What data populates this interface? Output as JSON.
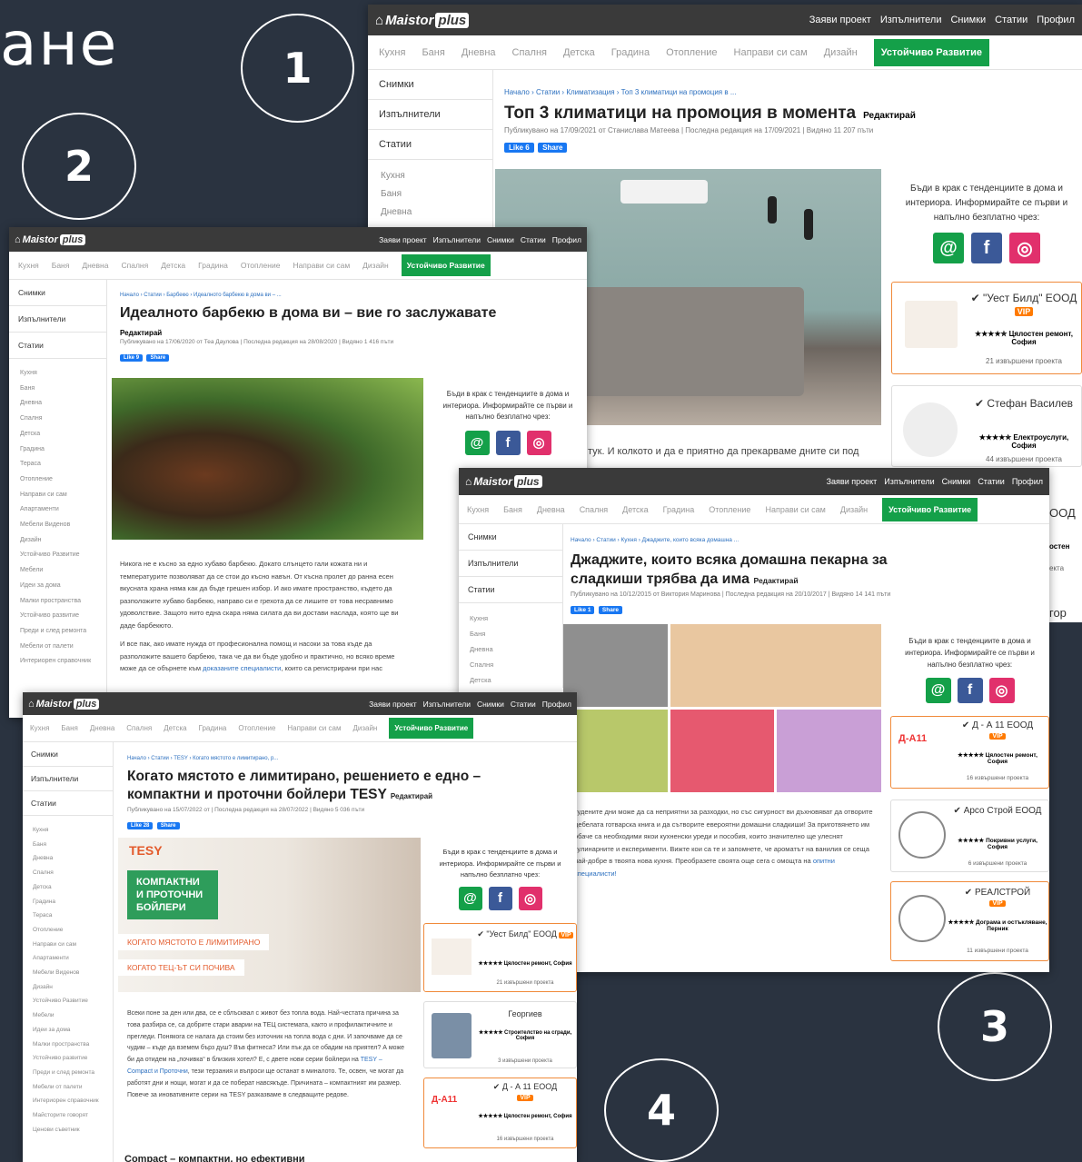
{
  "frag_top_left": "ане",
  "circles": [
    "1",
    "2",
    "3",
    "4"
  ],
  "common": {
    "logo_word": "Maistor",
    "logo_plus": "plus",
    "top_links": [
      "Заяви проект",
      "Изпълнители",
      "Снимки",
      "Статии",
      "Профил"
    ],
    "categories": [
      "Кухня",
      "Баня",
      "Дневна",
      "Спалня",
      "Детска",
      "Градина",
      "Отопление",
      "Направи си сам",
      "Дизайн"
    ],
    "green_cat": "Устойчиво Развитие",
    "side_menu": [
      "Снимки",
      "Изпълнители",
      "Статии"
    ],
    "edit": "Редактирай",
    "like": "Like",
    "share": "Share",
    "follow_text": "Бъди в крак с тенденциите в дома и интериора. Информирайте се първи и напълно безплатно чрез:",
    "social": [
      "@",
      "f",
      "◎"
    ],
    "vip": "VIP"
  },
  "s1": {
    "crumb": "Начало › Статии › Климатизация › Топ 3 климатици на промоция в ...",
    "title": "Топ 3 климатици на промоция в момента",
    "meta": "Публикувано на 17/09/2021 от Станислава Матеева | Последна редакция на 17/09/2021 | Видяно 11 207 пъти",
    "likes": "6",
    "side_sub": [
      "Кухня",
      "Баня",
      "Дневна"
    ],
    "body_line": "тук. И колкото и да е приятно да прекарваме дните си под",
    "card1_name": "\"Уест Билд\" ЕООД",
    "card1_desc": "Цялостен ремонт, София",
    "card1_projects": "21 извършени проекта",
    "card2_name": "Стефан Василев",
    "card2_desc": "Електроуслуги, София",
    "card2_projects": "44 извършени проекта",
    "peek_ood": "ООД",
    "peek_1": "остен",
    "peek_2": "екта",
    "peek_3": "гор"
  },
  "s2": {
    "crumb": "Начало › Статии › Барбекю › Идеалното барбекю в дома ви – ...",
    "title": "Идеалното барбекю в дома ви – вие го заслужавате",
    "meta": "Публикувано на 17/06/2020 от Теа Даулова | Последна редакция на 28/08/2020 | Видяно 1 416 пъти",
    "likes": "9",
    "side_sub": [
      "Кухня",
      "Баня",
      "Дневна",
      "Спалня",
      "Детска",
      "Градина",
      "Тераса",
      "Отопление",
      "Направи си сам",
      "Апартаменти",
      "Мебели Виденов",
      "Дизайн",
      "Устойчиво Развитие",
      "Мебели",
      "Идеи за дома",
      "Малки пространства",
      "Устойчиво развитие",
      "Преди и след ремонта",
      "Мебели от палети",
      "Интериорен справочник"
    ],
    "p1": "Никога не е късно за едно хубаво барбекю. Докато слънцето гали кожата ни и температурите позволяват да се стои до късно навън. От късна пролет до ранна есен вкусната храна няма как да бъде грешен избор. И ако имате пространство, където да разположите хубаво барбекю, направо си е грехота да се лишите от това несравнимо удоволствие. Защото нито една скара няма силата да ви достави наслада, която ще ви даде барбекюто.",
    "p2a": "И все пак, ако имате нужда от професионална помощ и насоки за това къде да разположите вашето барбекю, така че да ви бъде удобно и практично, но всяко време може да се обърнете към ",
    "p2link": "доказаните специалисти",
    "p2b": ", които са регистрирани при нас"
  },
  "s3": {
    "crumb": "Начало › Статии › Кухня › Джаджите, които всяка домашна ...",
    "title": "Джаджите, които всяка домашна пекарна за сладкиши трябва да има",
    "meta": "Публикувано на 10/12/2015 от Виктория Маринова | Последна редакция на 20/10/2017 | Видяно 14 141 пъти",
    "likes": "1",
    "side_sub": [
      "Кухня",
      "Баня",
      "Дневна",
      "Спалня",
      "Детска"
    ],
    "body": "тудените дни може да са неприятни за разходки, но със сигурност ви дъхновяват да отворите дебелата готварска книга и да сътворите евероятни домашни сладкиши! За приготвянето им обаче са необходими якои кухненски уреди и пособия, които значително ще улеснят кулинарните и експерименти. Вижте кои са те и запомнете, че ароматът на ванилия се сеща най-добре в твоята нова кухня. Преобразете своята още сега с омощта на ",
    "body_link": "опитни специалисти!",
    "card1_name": "Д - А 11 ЕООД",
    "card1_desc": "Цялостен ремонт, София",
    "card1_projects": "16 извършени проекта",
    "card2_name": "Арсо Строй ЕООД",
    "card2_desc": "Покривни услуги, София",
    "card2_projects": "6 извършени проекта",
    "card3_name": "РЕАЛСТРОЙ",
    "card3_desc": "Дограма и остъкляване, Перник",
    "card3_projects": "11 извършени проекта"
  },
  "s4": {
    "crumb": "Начало › Статии › TESY › Когато мястото е лимитирано, р...",
    "title": "Когато мястото е лимитирано, решението е едно – компактни и проточни бойлери TESY",
    "meta": "Публикувано на 15/07/2022 от | Последна редакция на 28/07/2022 | Видяно 5 036 пъти",
    "likes": "28",
    "side_sub": [
      "Кухня",
      "Баня",
      "Дневна",
      "Спалня",
      "Детска",
      "Градина",
      "Тераса",
      "Отопление",
      "Направи си сам",
      "Апартаменти",
      "Мебели Виденов",
      "Дизайн",
      "Устойчиво Развитие",
      "Мебели",
      "Идеи за дома",
      "Малки пространства",
      "Устойчиво развитие",
      "Преди и след ремонта",
      "Мебели от палети",
      "Интериорен справочник",
      "Майсторите говорят",
      "Ценови съветник"
    ],
    "ad_brand": "TESY",
    "ad_line1": "КОМПАКТНИ И ПРОТОЧНИ БОЙЛЕРИ",
    "ad_line2": "КОГАТО МЯСТОТО Е ЛИМИТИРАНО",
    "ad_line3": "КОГАТО ТЕЦ-ЪТ СИ ПОЧИВА",
    "body_a": "Всеки поне за ден или два, се е сблъсквал с живот без топла вода. Най-честата причина за това разбира се, са добрите стари аварии на ТЕЦ системата, както и профилактичните и прегледи. Понякога се налага да стоим без източник на топла вода с дни. И започваме да се чудим – къде да вземем бърз душ? Във фитнеса? Или пък да се обадим на приятел? А може би да отидем на „почивка“ в близкия хотел? Е, с двете нови серии бойлери на ",
    "body_link": "TESY – Compact и Проточни",
    "body_b": ", тези терзания и въпроси ще останат в миналото. Те, освен, че могат да работят дни и нощи, могат и да се поберат навсякъде. Причината – компактният им размер. Повече за иновативните серии на TESY разказваме в следващите редове.",
    "subhead": "Compact – компактни, но ефективни",
    "card1_name": "\"Уест Билд\" ЕООД",
    "card1_desc": "Цялостен ремонт, София",
    "card1_projects": "21 извършени проекта",
    "card2_name": "Георгиев",
    "card2_desc": "Строителство на сгради, София",
    "card2_projects": "3 извършени проекта",
    "card3_name": "Д - А 11 ЕООД",
    "card3_desc": "Цялостен ремонт, София",
    "card3_projects": "16 извършени проекта"
  }
}
